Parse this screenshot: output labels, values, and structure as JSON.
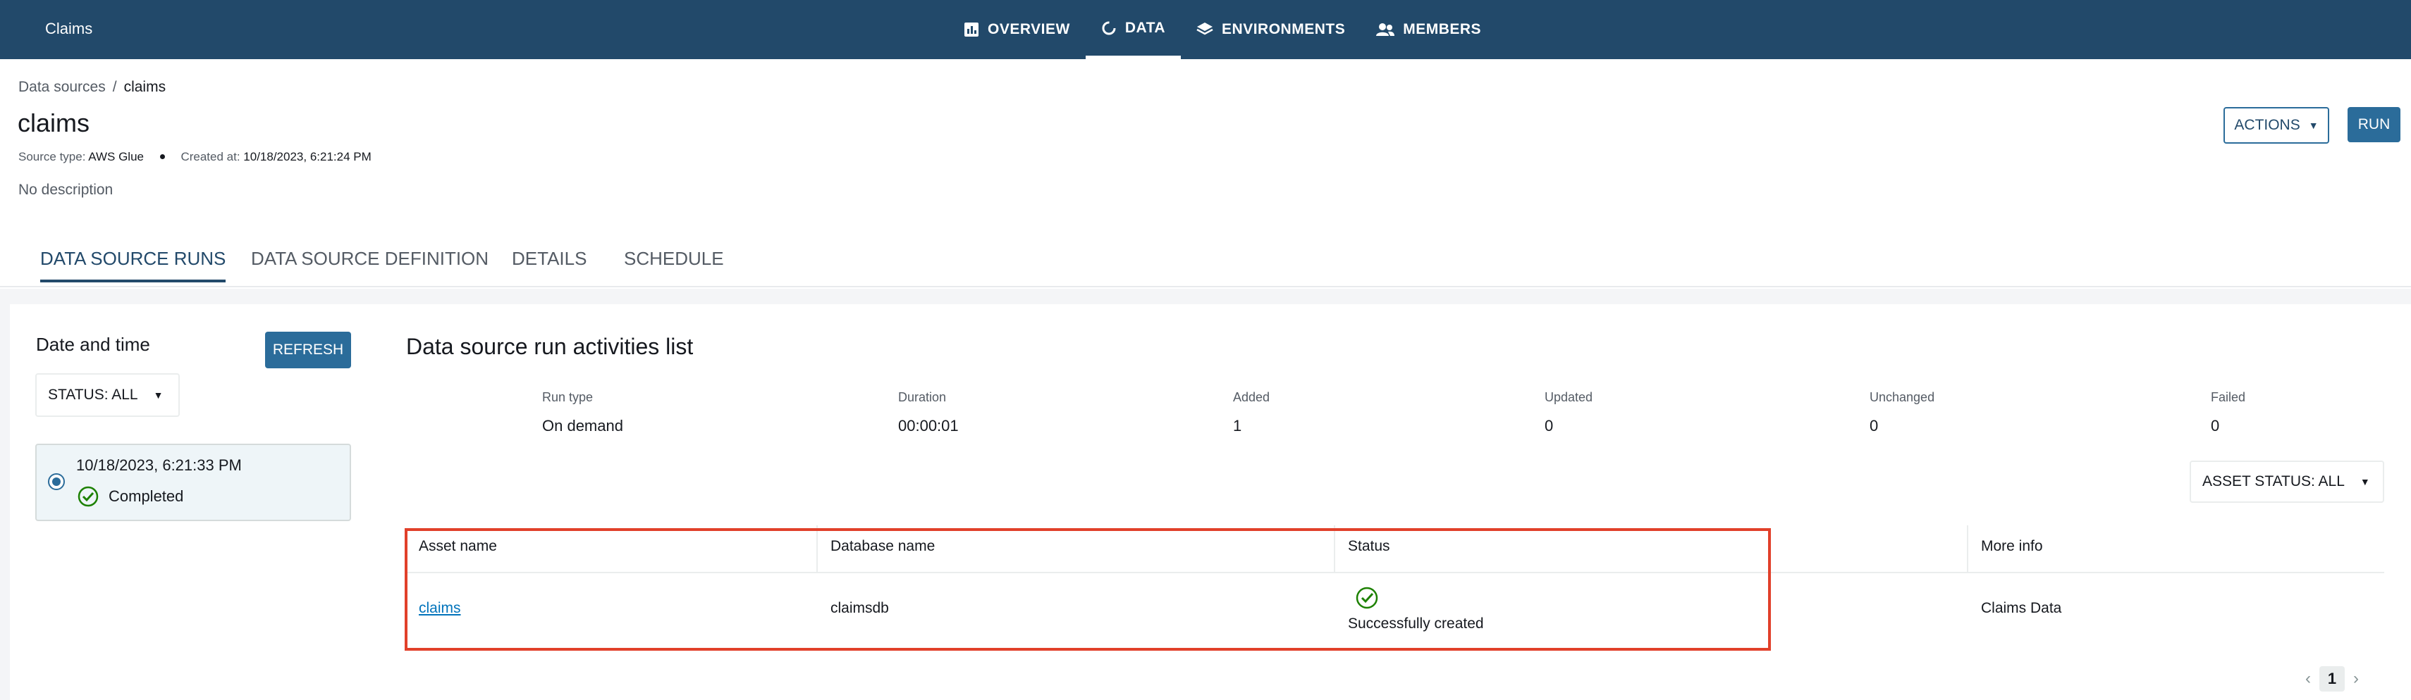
{
  "app": {
    "title": "Claims"
  },
  "nav": [
    {
      "label": "OVERVIEW",
      "icon": "chart-icon"
    },
    {
      "label": "DATA",
      "icon": "data-icon"
    },
    {
      "label": "ENVIRONMENTS",
      "icon": "layers-icon"
    },
    {
      "label": "MEMBERS",
      "icon": "users-icon"
    }
  ],
  "breadcrumb": {
    "parent": "Data sources",
    "separator": "/",
    "current": "claims"
  },
  "page": {
    "title": "claims",
    "source_type_label": "Source type:",
    "source_type_value": "AWS Glue",
    "created_label": "Created at:",
    "created_value": "10/18/2023, 6:21:24 PM",
    "description": "No description"
  },
  "buttons": {
    "actions": "ACTIONS",
    "run": "RUN",
    "refresh": "REFRESH"
  },
  "tabs": [
    {
      "label": "DATA SOURCE RUNS"
    },
    {
      "label": "DATA SOURCE DEFINITION"
    },
    {
      "label": "DETAILS"
    },
    {
      "label": "SCHEDULE"
    }
  ],
  "left_panel": {
    "title": "Date and time",
    "status_filter": "STATUS: ALL",
    "run": {
      "time": "10/18/2023, 6:21:33 PM",
      "status": "Completed"
    }
  },
  "main": {
    "title": "Data source run activities list",
    "stats": [
      {
        "label": "Run type",
        "value": "On demand"
      },
      {
        "label": "Duration",
        "value": "00:00:01"
      },
      {
        "label": "Added",
        "value": "1"
      },
      {
        "label": "Updated",
        "value": "0"
      },
      {
        "label": "Unchanged",
        "value": "0"
      },
      {
        "label": "Failed",
        "value": "0"
      }
    ],
    "asset_status_filter": "ASSET STATUS: ALL",
    "table": {
      "headers": [
        "Asset name",
        "Database name",
        "Status",
        "More info"
      ],
      "rows": [
        {
          "asset": "claims",
          "database": "claimsdb",
          "status": "Successfully created",
          "info": "Claims Data"
        }
      ]
    },
    "pagination": {
      "current_page": "1"
    }
  },
  "colors": {
    "header_bg": "#22496a",
    "accent": "#2b6c9a",
    "success": "#1d8102",
    "highlight": "#e1402a"
  }
}
